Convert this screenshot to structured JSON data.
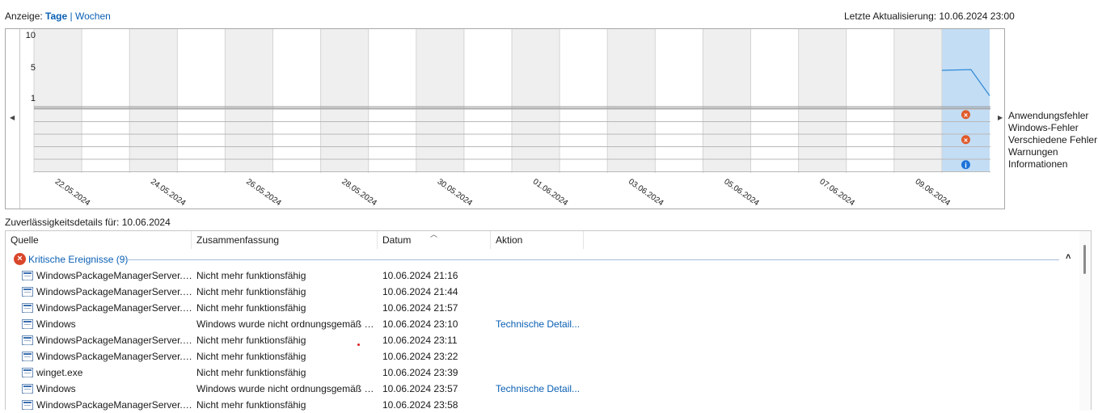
{
  "topbar": {
    "view_label": "Anzeige:",
    "view_days": "Tage",
    "separator": "|",
    "view_weeks": "Wochen",
    "last_update": "Letzte Aktualisierung: 10.06.2024 23:00"
  },
  "chart_data": {
    "type": "line",
    "ylim": [
      0,
      10
    ],
    "y_ticks": [
      "10",
      "5",
      "1"
    ],
    "x_labels": [
      "22.05.2024",
      "24.05.2024",
      "26.05.2024",
      "28.05.2024",
      "30.05.2024",
      "01.06.2024",
      "03.06.2024",
      "05.06.2024",
      "07.06.2024",
      "09.06.2024"
    ],
    "days_count": 20,
    "selected_day": "10.06.2024",
    "stability_series": [
      {
        "x": "10.06.2024",
        "y": 5.0
      },
      {
        "x": "10.06.2024",
        "y": 5.1
      },
      {
        "x": "10.06.2024",
        "y": 1.5
      }
    ],
    "legend": [
      "Anwendungsfehler",
      "Windows-Fehler",
      "Verschiedene Fehler",
      "Warnungen",
      "Informationen"
    ],
    "markers": [
      {
        "day": "10.06.2024",
        "row": "Anwendungsfehler",
        "icon": "critical-icon",
        "color": "#e05a2a"
      },
      {
        "day": "10.06.2024",
        "row": "Verschiedene Fehler",
        "icon": "critical-icon",
        "color": "#e05a2a"
      },
      {
        "day": "10.06.2024",
        "row": "Informationen",
        "icon": "info-icon",
        "color": "#1e73d8"
      }
    ],
    "colors": {
      "shade": "#efefef",
      "selected": "#c3ddf5",
      "line": "#2f8ad6"
    }
  },
  "details": {
    "title": "Zuverlässigkeitsdetails für: 10.06.2024",
    "columns": [
      "Quelle",
      "Zusammenfassung",
      "Datum",
      "Aktion"
    ],
    "group": {
      "icon": "critical-icon",
      "label": "Kritische Ereignisse (9)"
    },
    "rows": [
      {
        "source": "WindowsPackageManagerServer.exe",
        "summary": "Nicht mehr funktionsfähig",
        "date": "10.06.2024 21:16",
        "action": ""
      },
      {
        "source": "WindowsPackageManagerServer.exe",
        "summary": "Nicht mehr funktionsfähig",
        "date": "10.06.2024 21:44",
        "action": ""
      },
      {
        "source": "WindowsPackageManagerServer.exe",
        "summary": "Nicht mehr funktionsfähig",
        "date": "10.06.2024 21:57",
        "action": ""
      },
      {
        "source": "Windows",
        "summary": "Windows wurde nicht ordnungsgemäß heruntergefahren",
        "date": "10.06.2024 23:10",
        "action": "Technische Detail..."
      },
      {
        "source": "WindowsPackageManagerServer.exe",
        "summary": "Nicht mehr funktionsfähig",
        "date": "10.06.2024 23:11",
        "action": ""
      },
      {
        "source": "WindowsPackageManagerServer.exe",
        "summary": "Nicht mehr funktionsfähig",
        "date": "10.06.2024 23:22",
        "action": ""
      },
      {
        "source": "winget.exe",
        "summary": "Nicht mehr funktionsfähig",
        "date": "10.06.2024 23:39",
        "action": ""
      },
      {
        "source": "Windows",
        "summary": "Windows wurde nicht ordnungsgemäß heruntergefahren",
        "date": "10.06.2024 23:57",
        "action": "Technische Detail..."
      },
      {
        "source": "WindowsPackageManagerServer.exe",
        "summary": "Nicht mehr funktionsfähig",
        "date": "10.06.2024 23:58",
        "action": ""
      }
    ]
  }
}
